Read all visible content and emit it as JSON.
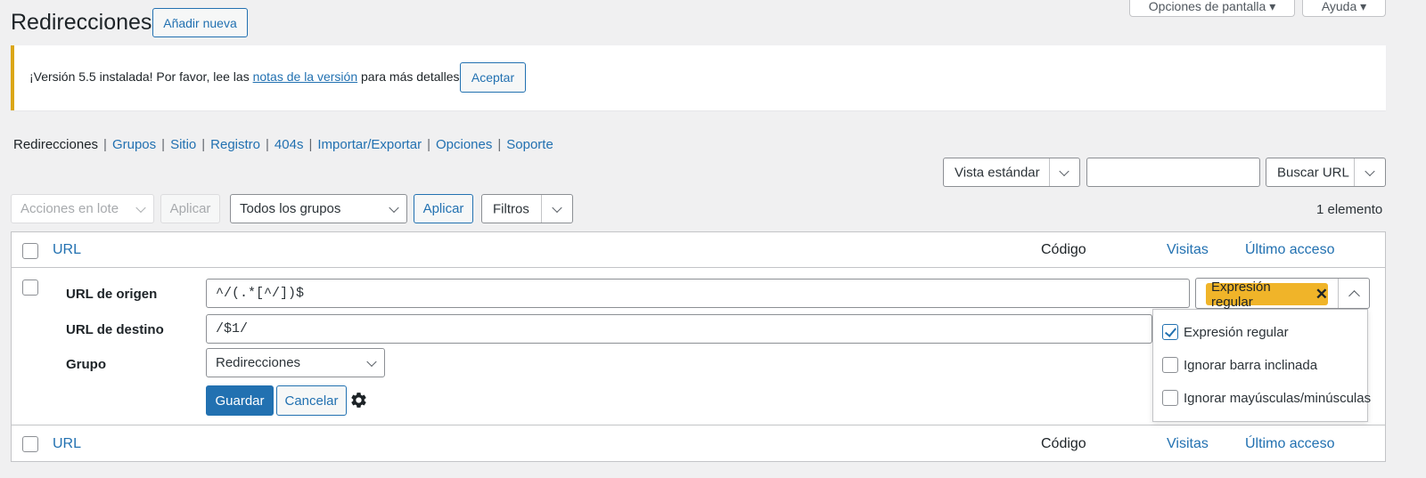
{
  "header": {
    "title": "Redirecciones",
    "add_new": "Añadir nueva",
    "screen_options": "Opciones de pantalla ▾",
    "help": "Ayuda ▾"
  },
  "notice": {
    "text_before": "¡Versión 5.5 instalada! Por favor, lee las ",
    "link": "notas de la versión",
    "text_after": " para más detalles.",
    "button": "Aceptar",
    "accent_color": "#dba617"
  },
  "subnav": {
    "items": [
      "Redirecciones",
      "Grupos",
      "Sitio",
      "Registro",
      "404s",
      "Importar/Exportar",
      "Opciones",
      "Soporte"
    ],
    "current": "Redirecciones"
  },
  "search": {
    "view": "Vista estándar",
    "input_value": "",
    "search_button": "Buscar URL"
  },
  "toolbar": {
    "bulk_actions": "Acciones en lote",
    "apply_disabled": "Aplicar",
    "group_filter": "Todos los grupos",
    "apply": "Aplicar",
    "filters": "Filtros",
    "count": "1 elemento"
  },
  "table": {
    "columns": [
      "URL",
      "Código",
      "Visitas",
      "Último acceso"
    ]
  },
  "edit_form": {
    "source_label": "URL de origen",
    "source_value": "^/(.*[^/])$",
    "target_label": "URL de destino",
    "target_value": "/$1/",
    "group_label": "Grupo",
    "group_value": "Redirecciones",
    "save": "Guardar",
    "cancel": "Cancelar",
    "settings_icon": "gear-icon"
  },
  "flags": {
    "selected_tag": "Expresión regular",
    "tag_color": "#f0b429",
    "options": [
      {
        "label": "Expresión regular",
        "checked": true
      },
      {
        "label": "Ignorar barra inclinada",
        "checked": false
      },
      {
        "label": "Ignorar mayúsculas/minúsculas",
        "checked": false
      }
    ]
  },
  "colors": {
    "primary": "#2271b1",
    "background": "#f0f0f1"
  }
}
